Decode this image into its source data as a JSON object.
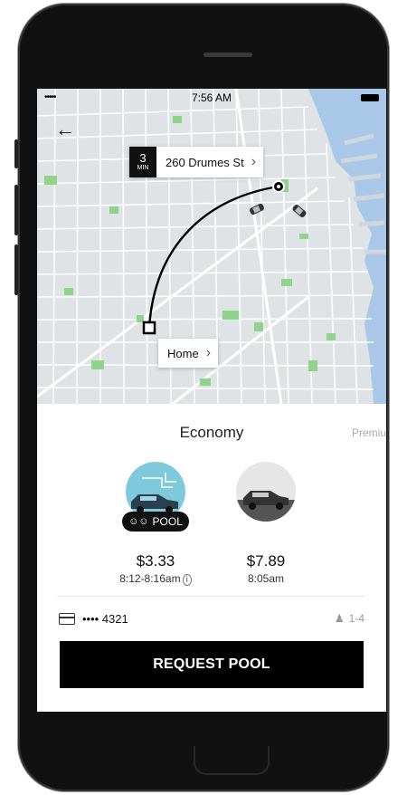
{
  "status_bar": {
    "time": "7:56 AM",
    "signal": "•••••"
  },
  "destination": {
    "eta_number": "3",
    "eta_unit": "MIN",
    "address": "260 Drumes St"
  },
  "pickup": {
    "label": "Home"
  },
  "products": {
    "current": "Economy",
    "next_partial": "Premiu",
    "options": [
      {
        "badge": "POOL",
        "price": "$3.33",
        "time": "8:12-8:16am"
      },
      {
        "price": "$7.89",
        "time": "8:05am"
      }
    ]
  },
  "payment": {
    "card": "•••• 4321",
    "riders": "1-4"
  },
  "request_button": "REQUEST POOL",
  "colors": {
    "map_bg": "#dfe3e6",
    "water": "#a9c8e8",
    "park": "#8fd48a",
    "pool_accent": "#7ec9dc"
  }
}
